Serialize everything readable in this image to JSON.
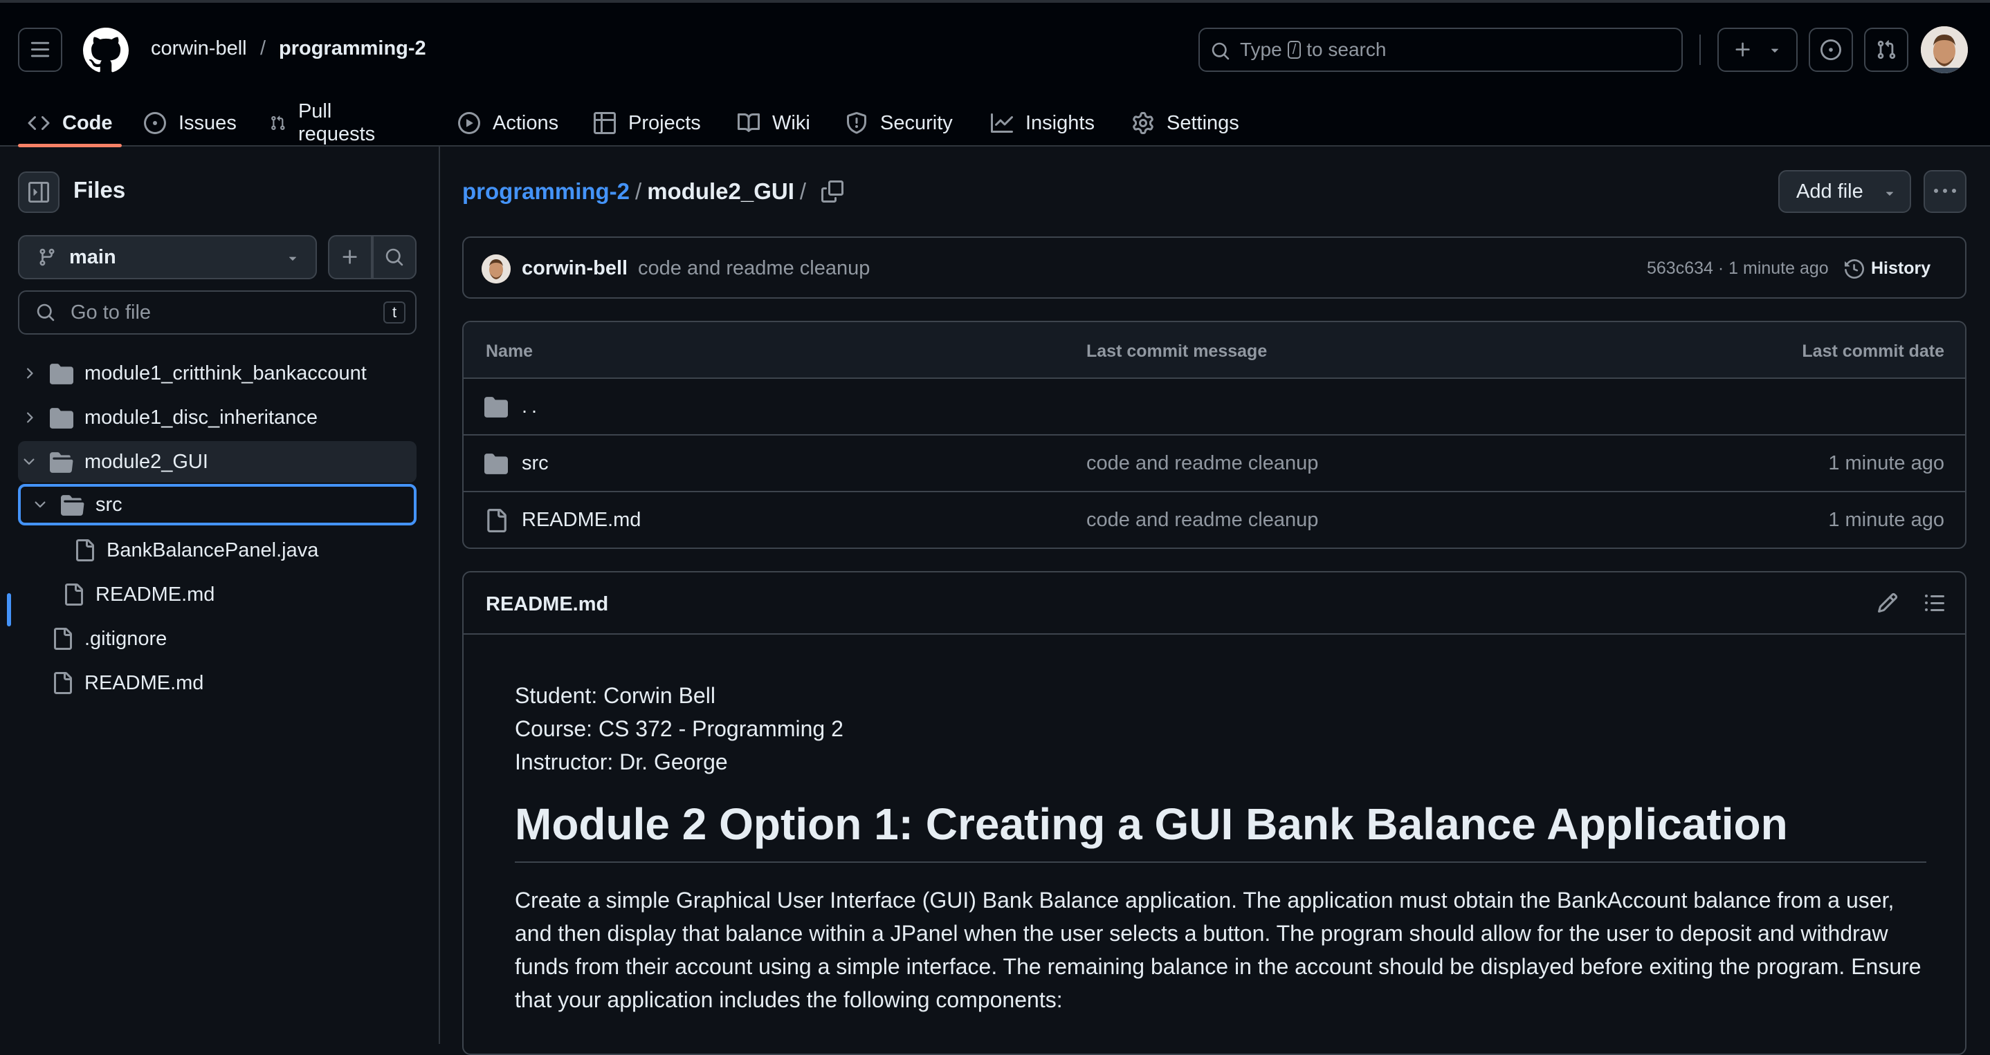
{
  "header": {
    "owner": "corwin-bell",
    "separator": "/",
    "repo": "programming-2",
    "search": {
      "prefix": "Type",
      "key": "/",
      "suffix": "to search"
    }
  },
  "tabs": [
    {
      "label": "Code",
      "icon": "code-icon",
      "active": true
    },
    {
      "label": "Issues",
      "icon": "issue-opened-icon"
    },
    {
      "label": "Pull requests",
      "icon": "git-pull-request-icon"
    },
    {
      "label": "Actions",
      "icon": "play-icon"
    },
    {
      "label": "Projects",
      "icon": "table-icon"
    },
    {
      "label": "Wiki",
      "icon": "book-icon"
    },
    {
      "label": "Security",
      "icon": "shield-icon"
    },
    {
      "label": "Insights",
      "icon": "graph-icon"
    },
    {
      "label": "Settings",
      "icon": "gear-icon"
    }
  ],
  "sidebar": {
    "title": "Files",
    "branch": "main",
    "goto_placeholder": "Go to file",
    "goto_key": "t",
    "tree": [
      {
        "label": "module1_critthink_bankaccount",
        "type": "folder",
        "expanded": false
      },
      {
        "label": "module1_disc_inheritance",
        "type": "folder",
        "expanded": false
      },
      {
        "label": "module2_GUI",
        "type": "folder",
        "expanded": true
      },
      {
        "label": "src",
        "type": "folder",
        "expanded": true,
        "selected": true
      },
      {
        "label": "BankBalancePanel.java",
        "type": "file"
      },
      {
        "label": "README.md",
        "type": "file"
      },
      {
        "label": ".gitignore",
        "type": "file"
      },
      {
        "label": "README.md",
        "type": "file"
      }
    ]
  },
  "breadcrumb": {
    "repo": "programming-2",
    "folder": "module2_GUI",
    "sep": "/"
  },
  "buttons": {
    "add_file": "Add file"
  },
  "commit": {
    "author": "corwin-bell",
    "message": "code and readme cleanup",
    "meta": "563c634 · 1 minute ago",
    "history": "History"
  },
  "table": {
    "headers": {
      "name": "Name",
      "message": "Last commit message",
      "date": "Last commit date"
    },
    "rows": [
      {
        "name": "..",
        "type": "folder",
        "message": "",
        "date": ""
      },
      {
        "name": "src",
        "type": "folder",
        "message": "code and readme cleanup",
        "date": "1 minute ago"
      },
      {
        "name": "README.md",
        "type": "file",
        "message": "code and readme cleanup",
        "date": "1 minute ago"
      }
    ]
  },
  "readme": {
    "title": "README.md",
    "lines": [
      "Student: Corwin Bell",
      "Course: CS 372 - Programming 2",
      "Instructor: Dr. George"
    ],
    "heading": "Module 2 Option 1: Creating a GUI Bank Balance Application",
    "body": "Create a simple Graphical User Interface (GUI) Bank Balance application. The application must obtain the BankAccount balance from a user, and then display that balance within a JPanel when the user selects a button. The program should allow for the user to deposit and withdraw funds from their account using a simple interface. The remaining balance in the account should be displayed before exiting the program. Ensure that your application includes the following components:"
  },
  "colors": {
    "accent": "#4493f8",
    "tab_underline": "#f78166",
    "background": "#0d1117",
    "header": "#010409"
  }
}
